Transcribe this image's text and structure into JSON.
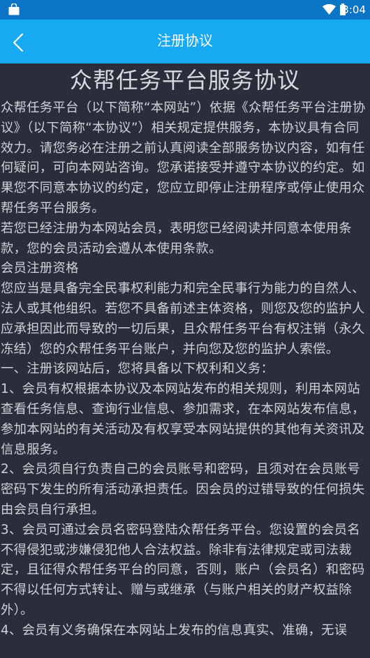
{
  "status_bar": {
    "time": "3:04",
    "left_icon": "shopping-bag-icon",
    "right_icons": [
      "wifi-icon",
      "battery-icon"
    ]
  },
  "app_bar": {
    "title": "注册协议",
    "back_icon": "chevron-left-icon"
  },
  "document": {
    "title": "众帮任务平台服务协议",
    "paragraphs": [
      "众帮任务平台（以下简称“本网站”）依据《众帮任务平台注册协议》（以下简称“本协议”）相关规定提供服务，本协议具有合同效力。请您务必在注册之前认真阅读全部服务协议内容，如有任何疑问，可向本网站咨询。您承诺接受并遵守本协议的约定。如果您不同意本协议的约定，您应立即停止注册程序或停止使用众帮任务平台服务。",
      "若您已经注册为本网站会员，表明您已经阅读并同意本使用条款，您的会员活动会遵从本使用条款。",
      "会员注册资格",
      "您应当是具备完全民事权利能力和完全民事行为能力的自然人、法人或其他组织。若您不具备前述主体资格，则您及您的监护人应承担因此而导致的一切后果，且众帮任务平台有权注销（永久冻结）您的众帮任务平台账户，并向您及您的监护人索偿。",
      "一、注册该网站后，您将具备以下权利和义务：",
      "1、会员有权根据本协议及本网站发布的相关规则，利用本网站查看任务信息、查询行业信息、参加需求，在本网站发布信息，参加本网站的有关活动及有权享受本网站提供的其他有关资讯及信息服务。",
      "2、会员须自行负责自己的会员账号和密码，且须对在会员账号密码下发生的所有活动承担责任。因会员的过错导致的任何损失由会员自行承担。",
      "3、会员可通过会员名密码登陆众帮任务平台。您设置的会员名不得侵犯或涉嫌侵犯他人合法权益。除非有法律规定或司法裁定，且征得众帮任务平台的同意，否则，账户（会员名）和密码不得以任何方式转让、赠与或继承（与账户相关的财产权益除外）。",
      "4、会员有义务确保在本网站上发布的信息真实、准确，无误"
    ]
  }
}
